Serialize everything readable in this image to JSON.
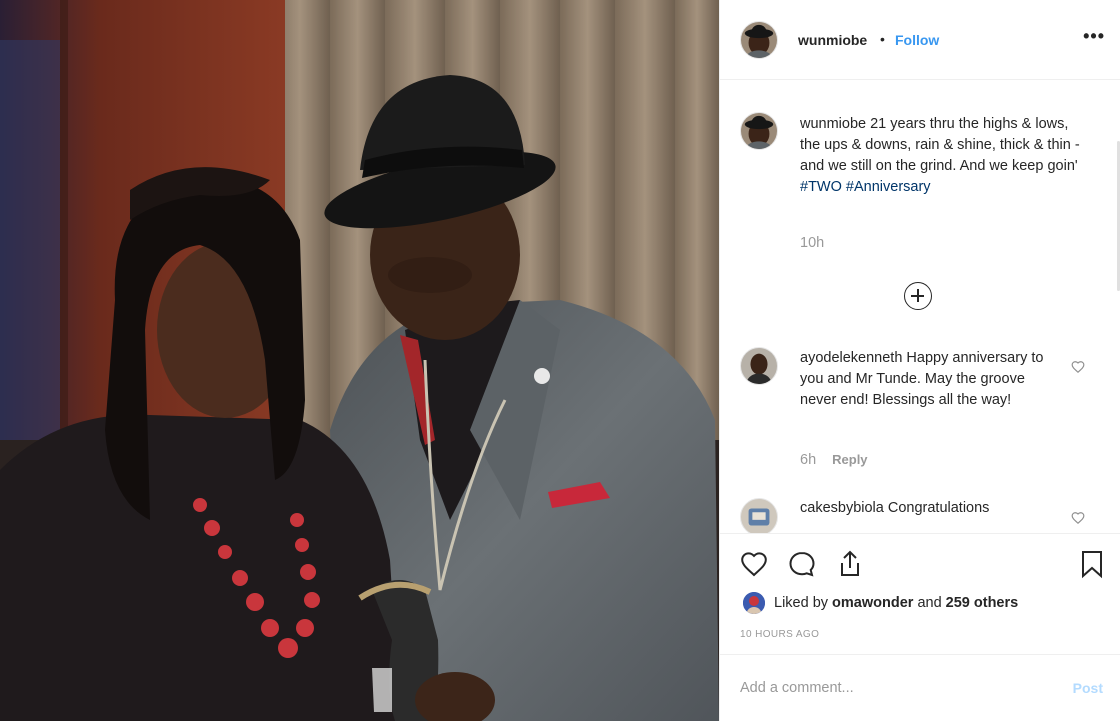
{
  "post": {
    "username": "wunmiobe",
    "separator": "•",
    "follow_label": "Follow",
    "more_label": "•••",
    "caption": {
      "username": "wunmiobe",
      "text": " 21 years thru the highs & lows, the ups & downs, rain & shine, thick & thin - and we still on the grind. And we keep goin' ",
      "hashtag_1": "#TWO",
      "hashtag_2": "#Anniversary",
      "time": "10h"
    },
    "comments": [
      {
        "username": "ayodelekenneth",
        "text": " Happy anniversary to you and Mr Tunde. May the groove never end! Blessings all the way!",
        "time": "6h",
        "reply_label": "Reply"
      },
      {
        "username": "cakesbybiola",
        "text": " Congratulations"
      }
    ],
    "likes": {
      "prefix": "Liked by ",
      "user": "omawonder",
      "mid": " and ",
      "others": "259 others"
    },
    "posted_ago": "10 HOURS AGO",
    "add_comment": {
      "placeholder": "Add a comment...",
      "post_label": "Post"
    }
  },
  "icons": {
    "heart": "heart-icon",
    "comment": "comment-icon",
    "share": "share-icon",
    "save": "bookmark-icon",
    "more": "more-options-icon",
    "load_more": "plus-circle-icon"
  },
  "colors": {
    "link": "#3897f0",
    "hashtag": "#003569",
    "muted": "#999999",
    "post_disabled": "#b3dbff"
  }
}
